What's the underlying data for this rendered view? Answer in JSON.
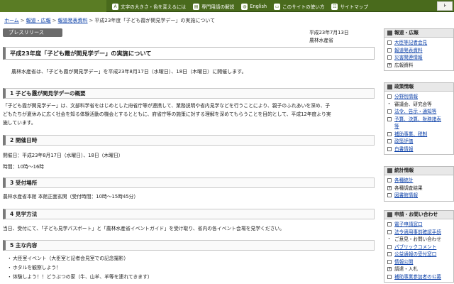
{
  "topnav": [
    {
      "label": "文字の大きさ・色を変えるには",
      "icon": "text-size-icon"
    },
    {
      "label": "専門用語の解説",
      "icon": "book-icon"
    },
    {
      "label": "English",
      "icon": "globe-icon"
    },
    {
      "label": "このサイトの使い方",
      "icon": "monitor-icon"
    },
    {
      "label": "サイトマップ",
      "icon": "sitemap-icon"
    }
  ],
  "topbar_right": "ト",
  "breadcrumb": {
    "items": [
      "ホーム",
      "報道・広報",
      "報道発表資料"
    ],
    "current": "平成23年度「子ども霞が関見学デー」の実施について",
    "separator": ">"
  },
  "press_badge": "プレスリリース",
  "date": "平成23年7月13日",
  "ministry": "農林水産省",
  "title": "平成23年度「子ども霞が関見学デー」の実施について",
  "lead": "農林水産省は、「子ども霞が関見学デー」を平成23年8月17日（水曜日）、18日（木曜日）に開催します。",
  "sections": [
    {
      "heading": "1 子ども霞が関見学デーの概要",
      "body": [
        "「子ども霞が関見学デー」は、文部科学省をはじめとした府省庁等が連携して、業務説明や省内見学などを行うことにより、親子のふれあいを深め、子",
        "どもたちが夏休みに広く社会を知る体験活動の機会とするとともに、府省庁等の施策に対する理解を深めてもらうことを目的として、平成12年度より実",
        "施しています。"
      ]
    },
    {
      "heading": "2 開催日時",
      "body": [
        "開催日：平成23年8月17日（水曜日）、18日（木曜日）",
        "時間：10時～16時"
      ]
    },
    {
      "heading": "3 受付場所",
      "body": [
        "農林水産省本館 本館正面玄関（受付時間：10時～15時45分）"
      ]
    },
    {
      "heading": "4 見学方法",
      "body": [
        "当日、受付にて、「子ども見学パスポート」と「農林水産省イベントガイド」を受け取り、省内の各イベント会場を見学ください。"
      ]
    },
    {
      "heading": "5 主な内容",
      "body": [
        "大臣室イベント（大臣室と記者会見室での記念撮影）",
        "ホタルを観察しよう！",
        "体験しよう！！どうぶつの家（牛、山羊、羊等を連れてきます）"
      ]
    }
  ],
  "sidebar": {
    "boxes": [
      {
        "title": "報道・広報",
        "items": [
          {
            "label": "大臣等記者会見",
            "link": true,
            "bullet": "box"
          },
          {
            "label": "報道発表資料",
            "link": true,
            "bullet": "box"
          },
          {
            "label": "災害関連情報",
            "link": true,
            "bullet": "box"
          },
          {
            "label": "広報資料",
            "link": false,
            "bullet": "plus"
          }
        ]
      },
      {
        "title": "政策情報",
        "items": [
          {
            "label": "分野別情報",
            "link": true,
            "bullet": "box"
          },
          {
            "label": "審議会、研究会等",
            "link": false,
            "bullet": "dot"
          },
          {
            "label": "法令、告示・通知等",
            "link": true,
            "bullet": "box"
          },
          {
            "label": "予算、決算、財務諸表",
            "link": true,
            "bullet": "box"
          },
          {
            "label": "等",
            "link": true,
            "bullet": "none"
          },
          {
            "label": "補助事業、税制",
            "link": true,
            "bullet": "box"
          },
          {
            "label": "政策評価",
            "link": true,
            "bullet": "box"
          },
          {
            "label": "白書情報",
            "link": true,
            "bullet": "box"
          }
        ]
      },
      {
        "title": "統計情報",
        "items": [
          {
            "label": "各種統計",
            "link": true,
            "bullet": "box"
          },
          {
            "label": "各種調査結果",
            "link": false,
            "bullet": "plus"
          },
          {
            "label": "図書館情報",
            "link": true,
            "bullet": "box"
          }
        ]
      },
      {
        "title": "申請・お問い合わせ",
        "items": [
          {
            "label": "電子申請窓口",
            "link": true,
            "bullet": "box"
          },
          {
            "label": "法令適用事前確認手続",
            "link": true,
            "bullet": "box"
          },
          {
            "label": "ご意見・お問い合わせ",
            "link": false,
            "bullet": "dot"
          },
          {
            "label": "パブリックコメント",
            "link": true,
            "bullet": "box"
          },
          {
            "label": "公益通報の受付窓口",
            "link": true,
            "bullet": "box"
          },
          {
            "label": "情報公開",
            "link": true,
            "bullet": "box"
          },
          {
            "label": "調達・入札",
            "link": false,
            "bullet": "plus"
          },
          {
            "label": "補助事業参加者の公募",
            "link": true,
            "bullet": "box"
          }
        ]
      }
    ]
  }
}
